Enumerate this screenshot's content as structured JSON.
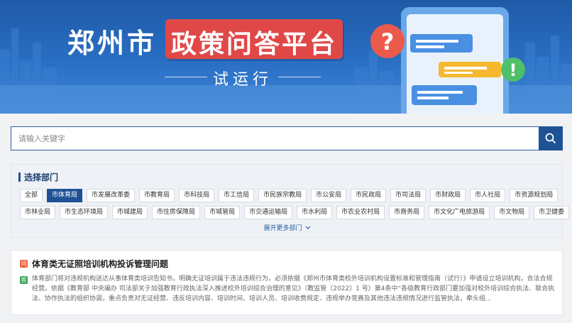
{
  "banner": {
    "title_city": "郑州市",
    "title_platform": "政策问答平台",
    "subtitle": "试运行"
  },
  "search": {
    "placeholder": "请输入关键字",
    "value": ""
  },
  "departments": {
    "title": "选择部门",
    "rows": [
      [
        "全部",
        "市体育局",
        "市发展改革委",
        "市教育局",
        "市科技局",
        "市工信局",
        "市民族宗教局",
        "市公安局",
        "市民政局",
        "市司法局",
        "市财政局",
        "市人社局",
        "市资源规划局"
      ],
      [
        "市林业局",
        "市生态环境局",
        "市城建局",
        "市住房保障局",
        "市城管局",
        "市交通运输局",
        "市水利局",
        "市农业农村局",
        "市商务局",
        "市文化广电旅游局",
        "市文物局",
        "市卫健委"
      ]
    ],
    "active": "市体育局",
    "expand_label": "展开更多部门"
  },
  "qa": {
    "q_badge": "问",
    "a_badge": "答",
    "question": "体育类无证照培训机构投诉管理问题",
    "answer": "体育部门将对违规机构送达从事体育类培训告知书，明确无证培训属于违法违规行为，必须依据《郑州市体育类校外培训机构设置标准和管理指南（试行）》申请设立培训机构，合法合规经营。依据《教育部 中央编办 司法部关于加强教育行政执法深入推进校外培训综合治理的意见》（教监管〔2022〕1 号）第4条中“各级教育行政部门要加强对校外培训综合执法、联合执法、协作执法的组织协调，重点负责对无证经营、违反培训内容、培训时间、培训人员、培训收费规定、违规举办竞赛及其他违法违规情况进行监管执法，牵头组..."
  },
  "colors": {
    "banner_blue": "#2a6fc4",
    "accent_red": "#e04848",
    "primary": "#1e5294"
  }
}
